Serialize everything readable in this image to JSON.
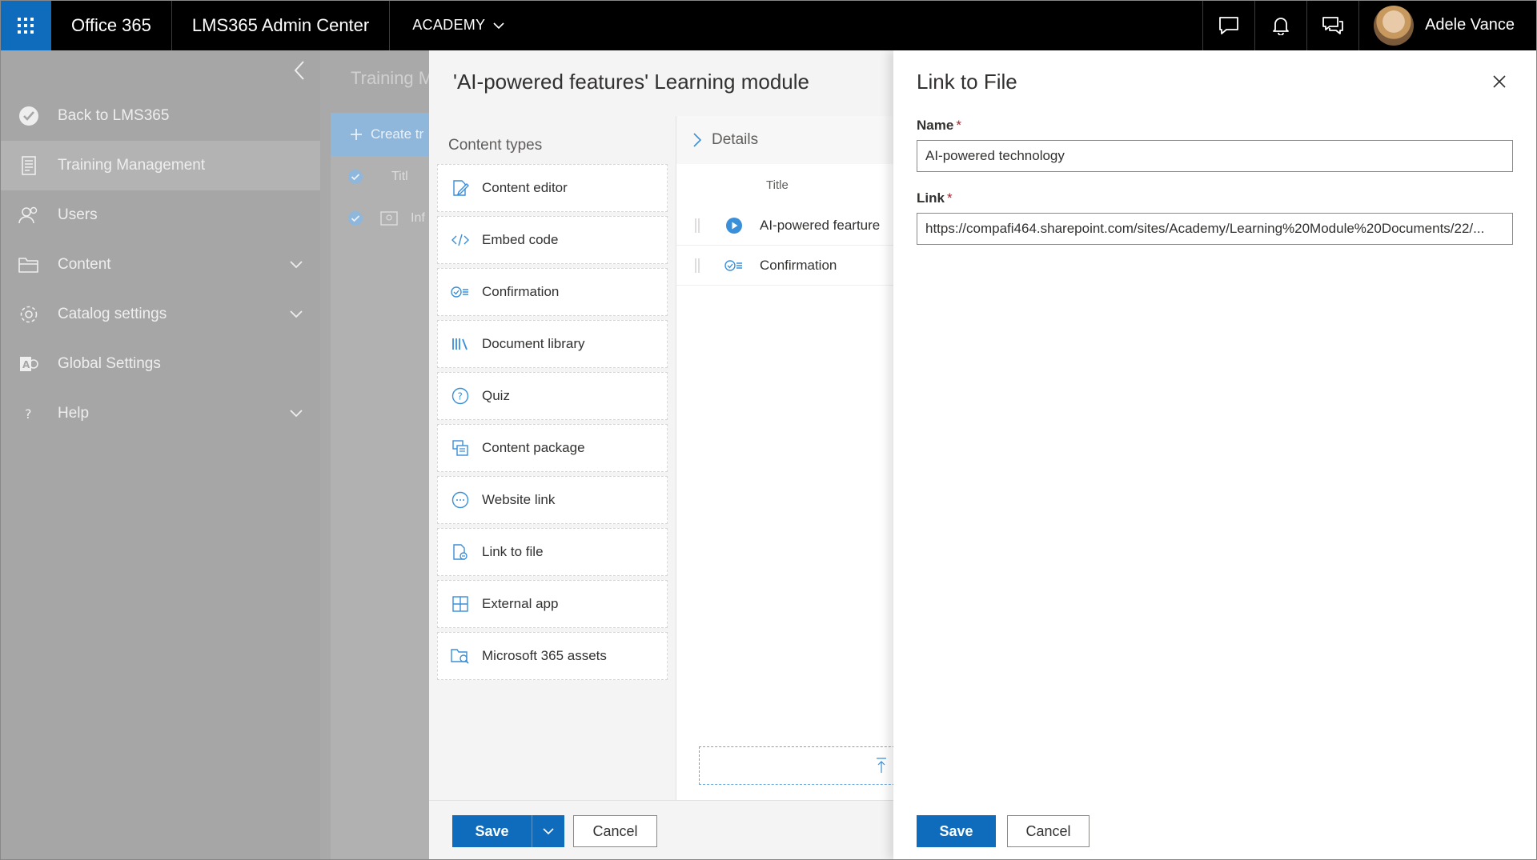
{
  "topbar": {
    "app_name": "Office 365",
    "product": "LMS365 Admin Center",
    "tenant": "ACADEMY",
    "user_name": "Adele Vance",
    "icons": [
      "waffle-icon",
      "chat-icon",
      "bell-icon",
      "feedback-icon"
    ]
  },
  "nav": {
    "items": [
      {
        "label": "Back to LMS365",
        "icon": "checkmark-circle-icon"
      },
      {
        "label": "Training Management",
        "icon": "document-icon"
      },
      {
        "label": "Users",
        "icon": "people-icon"
      },
      {
        "label": "Content",
        "icon": "folder-icon"
      },
      {
        "label": "Catalog settings",
        "icon": "gear-icon"
      },
      {
        "label": "Global Settings",
        "icon": "admin-icon"
      },
      {
        "label": "Help",
        "icon": "question-icon"
      }
    ]
  },
  "background_page": {
    "title": "Training M",
    "create_label": "Create tr",
    "col_title": "Titl",
    "row_text": "Inf"
  },
  "module": {
    "title": "'AI-powered features' Learning module",
    "content_types_heading": "Content types",
    "content_types": [
      {
        "label": "Content editor",
        "icon": "edit-icon"
      },
      {
        "label": "Embed code",
        "icon": "code-icon"
      },
      {
        "label": "Confirmation",
        "icon": "confirmation-icon"
      },
      {
        "label": "Document library",
        "icon": "library-icon"
      },
      {
        "label": "Quiz",
        "icon": "question-circle-icon"
      },
      {
        "label": "Content package",
        "icon": "package-icon"
      },
      {
        "label": "Website link",
        "icon": "link-icon"
      },
      {
        "label": "Link to file",
        "icon": "file-link-icon"
      },
      {
        "label": "External app",
        "icon": "app-icon"
      },
      {
        "label": "Microsoft 365 assets",
        "icon": "folder-search-icon"
      }
    ],
    "details_heading": "Details",
    "details_col_title": "Title",
    "details_rows": [
      {
        "title": "AI-powered fearture",
        "icon": "play-icon"
      },
      {
        "title": "Confirmation",
        "icon": "confirmation-icon"
      }
    ],
    "save_label": "Save",
    "cancel_label": "Cancel"
  },
  "link_panel": {
    "title": "Link to File",
    "name_label": "Name",
    "name_value": "AI-powered technology",
    "link_label": "Link",
    "link_value": "https://compafi464.sharepoint.com/sites/Academy/Learning%20Module%20Documents/22/...",
    "required_mark": "*",
    "save_label": "Save",
    "cancel_label": "Cancel"
  },
  "colors": {
    "accent": "#0f6cbd",
    "topbar": "#000000",
    "overlay_gray": "#a6a6a6",
    "required": "#a4262c"
  }
}
